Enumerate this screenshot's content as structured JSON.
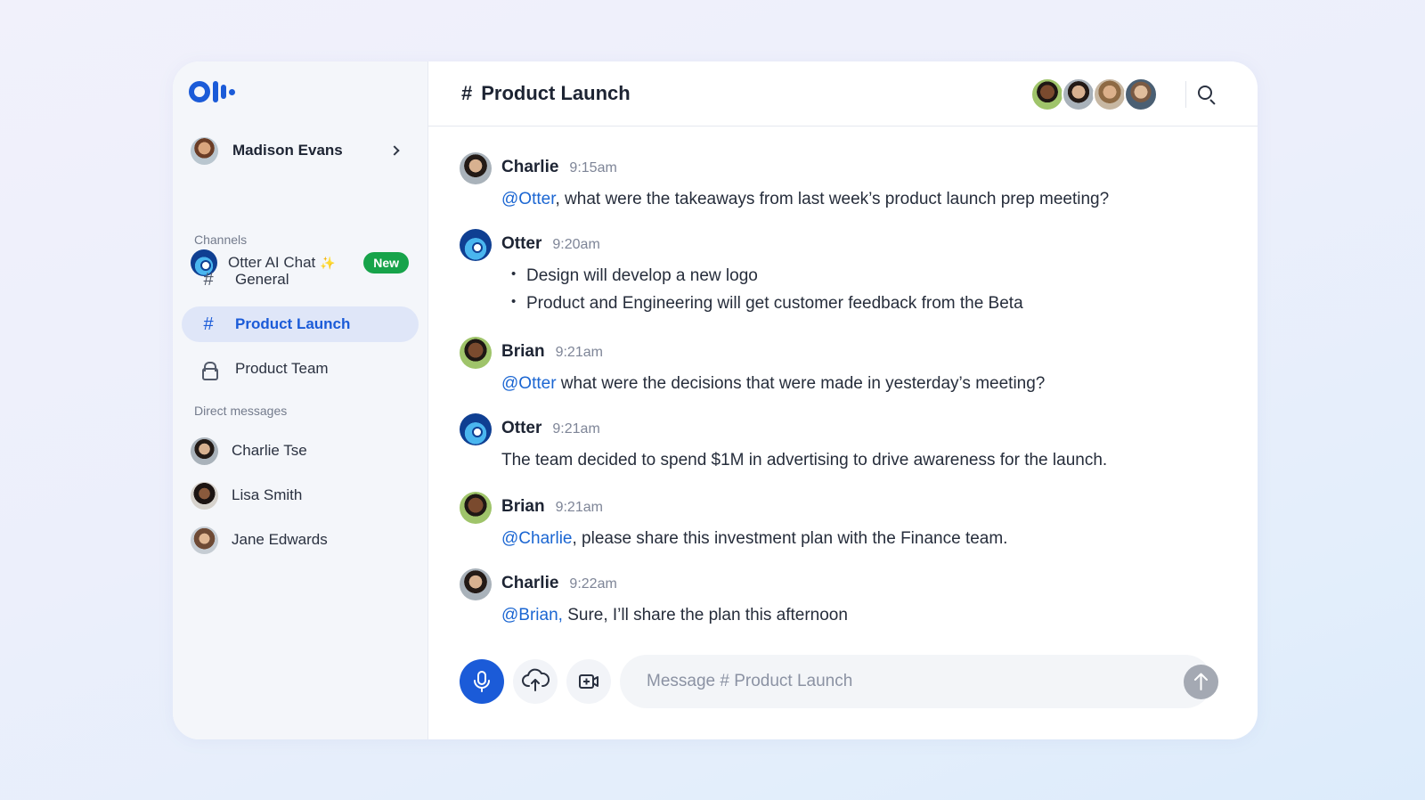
{
  "brand": {
    "logo_name": "otter-logo",
    "accent": "#1b5bd8"
  },
  "sidebar": {
    "user": {
      "name": "Madison Evans"
    },
    "ai_chat": {
      "label": "Otter AI Chat",
      "sparkle": "✨",
      "badge": "New"
    },
    "channels_label": "Channels",
    "channels": [
      {
        "label": "General",
        "icon": "hash-icon",
        "active": false
      },
      {
        "label": "Product Launch",
        "icon": "hash-icon",
        "active": true
      },
      {
        "label": "Product Team",
        "icon": "lock-icon",
        "active": false
      }
    ],
    "dm_label": "Direct messages",
    "direct_messages": [
      {
        "label": "Charlie Tse"
      },
      {
        "label": "Lisa Smith"
      },
      {
        "label": "Jane Edwards"
      }
    ]
  },
  "header": {
    "hash": "#",
    "title": "Product Launch"
  },
  "messages": [
    {
      "author": "Charlie",
      "time": "9:15am",
      "mention": "@Otter",
      "text": ", what were the takeaways from last week’s product launch prep meeting?"
    },
    {
      "author": "Otter",
      "time": "9:20am",
      "bullets": [
        "Design will develop a new logo",
        "Product and Engineering will get customer feedback from the Beta"
      ]
    },
    {
      "author": "Brian",
      "time": "9:21am",
      "mention": "@Otter",
      "text": " what were the decisions that were made in yesterday’s meeting?"
    },
    {
      "author": "Otter",
      "time": "9:21am",
      "mention": "",
      "text": "The team decided to spend $1M in advertising to drive awareness for the launch."
    },
    {
      "author": "Brian",
      "time": "9:21am",
      "mention": "@Charlie",
      "text": ", please share this investment plan with the Finance team."
    },
    {
      "author": "Charlie",
      "time": "9:22am",
      "mention": "@Brian,",
      "text": " Sure, I’ll share the plan this afternoon"
    }
  ],
  "composer": {
    "placeholder": "Message # Product Launch"
  }
}
